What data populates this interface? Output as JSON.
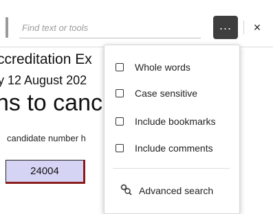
{
  "search": {
    "placeholder": "Find text or tools"
  },
  "toolbar": {
    "more_label": "...",
    "close_label": "×"
  },
  "document": {
    "line1": "ccreditation Ex",
    "line2": "y 12 August 202",
    "line3": "ns to canc",
    "line4": "candidate number h",
    "candidate_number": "24004"
  },
  "options_menu": {
    "items": [
      {
        "label": "Whole words",
        "checked": false
      },
      {
        "label": "Case sensitive",
        "checked": false
      },
      {
        "label": "Include bookmarks",
        "checked": false
      },
      {
        "label": "Include comments",
        "checked": false
      }
    ],
    "advanced_search": {
      "label": "Advanced search",
      "icon": "advanced-search-icon"
    }
  },
  "colors": {
    "more_button": "#3e3e3e",
    "candidate_box": "#d6d4f4",
    "candidate_box_border": "#8b1a1a"
  }
}
